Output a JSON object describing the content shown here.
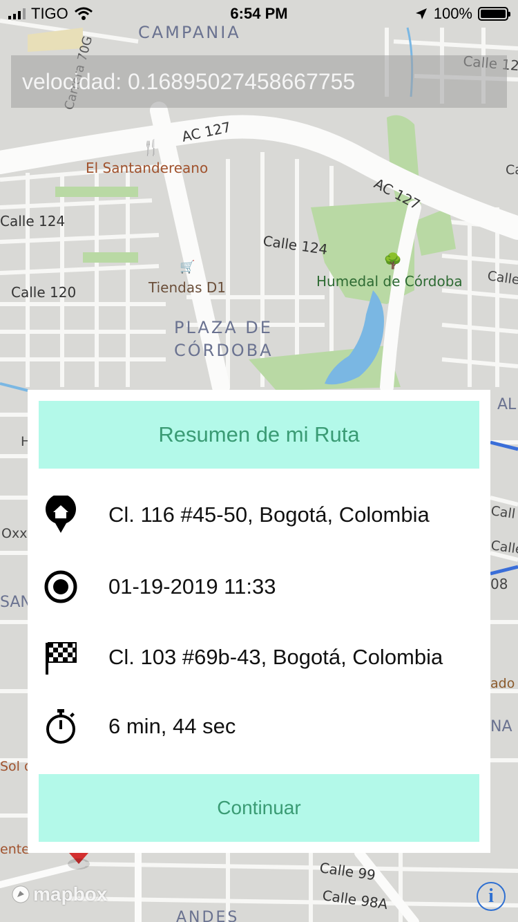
{
  "status_bar": {
    "carrier": "TIGO",
    "time": "6:54 PM",
    "battery": "100%"
  },
  "speed_overlay": {
    "text": "velocidad: 0.16895027458667755"
  },
  "map": {
    "labels": {
      "campania": "CAMPANIA",
      "carrera70g": "Carrera 70G",
      "ac127a": "AC 127",
      "ac127b": "AC 127",
      "calle12": "Calle 12",
      "santandereano": "El Santandereano",
      "calle124a": "Calle 124",
      "calle124b": "Calle 124",
      "calle120": "Calle 120",
      "tiendas": "Tiendas D1",
      "humedal": "Humedal de Córdoba",
      "plaza1": "PLAZA DE",
      "plaza2": "CÓRDOBA",
      "calle99": "Calle 99",
      "calle98a": "Calle 98A",
      "andes": "ANDES",
      "al": "AL",
      "call1": "Call",
      "call2": "Calle",
      "n08": "08",
      "ado": "ado l",
      "na": "NA",
      "oxx": "Oxx",
      "san": "SAN",
      "sol": "Sol d",
      "ente": "ente",
      "ca": "Ca",
      "calle_r": "Calle",
      "h": "H"
    },
    "attribution": "mapbox",
    "colors": {
      "land": "#d9d9d6",
      "road": "#f7f7f5",
      "park": "#b9d9a4",
      "water": "#7ab7e3",
      "route": "#3a6ed8"
    }
  },
  "route_summary": {
    "title": "Resumen de mi Ruta",
    "origin_address": "Cl. 116 #45-50, Bogotá, Colombia",
    "start_datetime": "01-19-2019 11:33",
    "destination_address": "Cl. 103 #69b-43, Bogotá, Colombia",
    "duration": "6 min, 44 sec",
    "continue_label": "Continuar",
    "icons": [
      "home-pin-icon",
      "record-icon",
      "checkered-flag-icon",
      "stopwatch-icon"
    ],
    "accent_bg": "#b3f9e9",
    "accent_text": "#3a9b74"
  }
}
